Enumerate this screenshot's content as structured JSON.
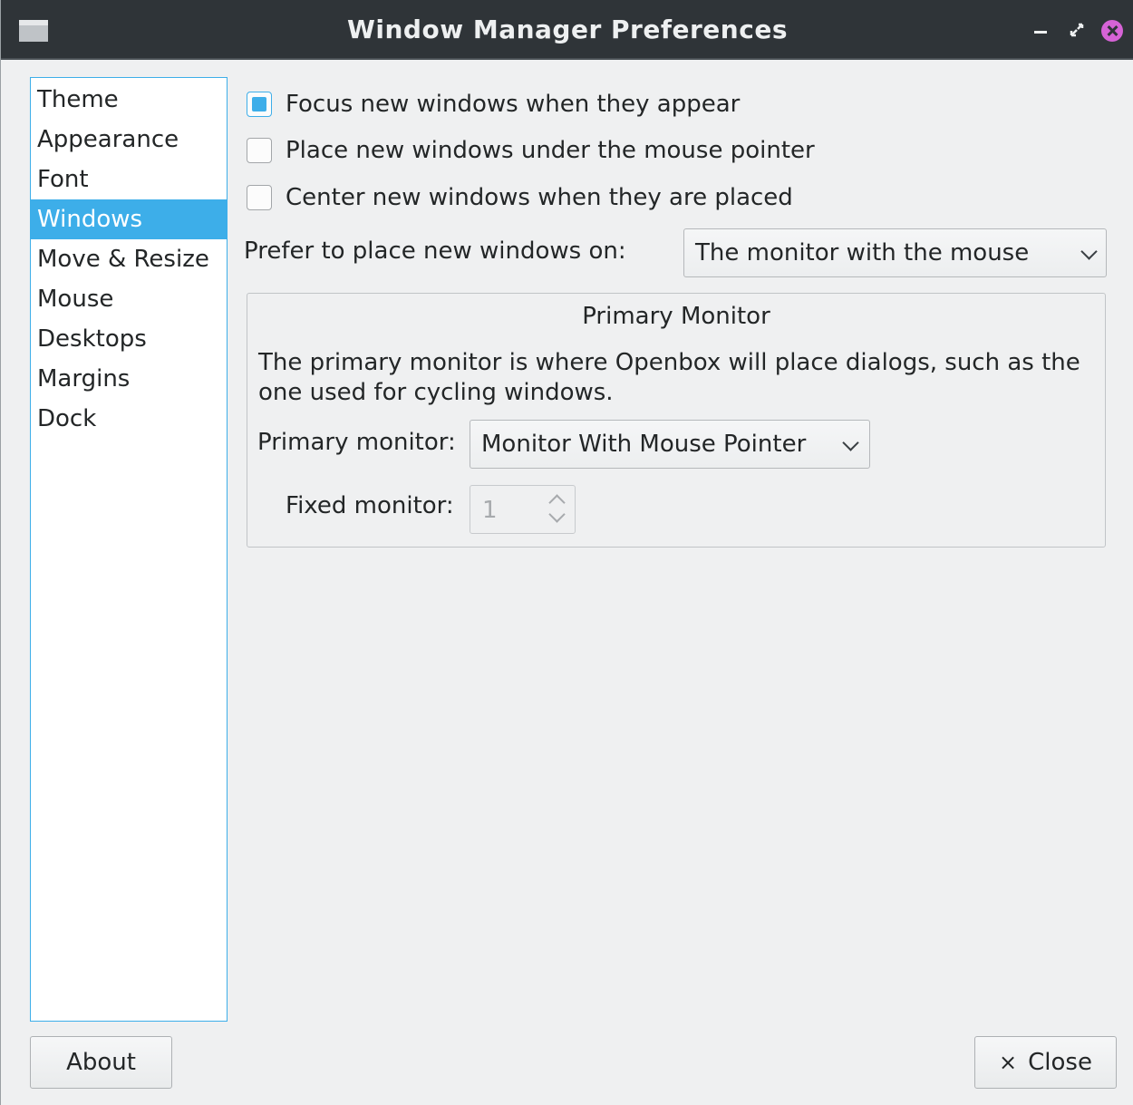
{
  "window": {
    "title": "Window Manager Preferences",
    "controls": {
      "minimize_icon": "minimize-icon",
      "maximize_icon": "maximize-icon",
      "close_icon": "close-icon"
    }
  },
  "sidebar": {
    "selected": "Windows",
    "items": [
      {
        "label": "Theme"
      },
      {
        "label": "Appearance"
      },
      {
        "label": "Font"
      },
      {
        "label": "Windows"
      },
      {
        "label": "Move & Resize"
      },
      {
        "label": "Mouse"
      },
      {
        "label": "Desktops"
      },
      {
        "label": "Margins"
      },
      {
        "label": "Dock"
      }
    ]
  },
  "options": {
    "focus_new": {
      "label": "Focus new windows when they appear",
      "checked": true
    },
    "place_under_mouse": {
      "label": "Place new windows under the mouse pointer",
      "checked": false
    },
    "center_new": {
      "label": "Center new windows when they are placed",
      "checked": false
    },
    "prefer_place": {
      "label": "Prefer to place new windows on:",
      "value": "The monitor with the mouse"
    }
  },
  "primary_monitor_group": {
    "title": "Primary Monitor",
    "description": "The primary monitor is where Openbox will place dialogs, such as the one used for cycling windows.",
    "primary_label": "Primary monitor:",
    "primary_value": "Monitor With Mouse Pointer",
    "fixed_label": "Fixed monitor:",
    "fixed_value": "1"
  },
  "buttons": {
    "about": "About",
    "close": "Close",
    "close_icon": "×"
  },
  "colors": {
    "accent": "#3daee9",
    "titlebar": "#2f3438",
    "close_button": "#d663d6"
  }
}
